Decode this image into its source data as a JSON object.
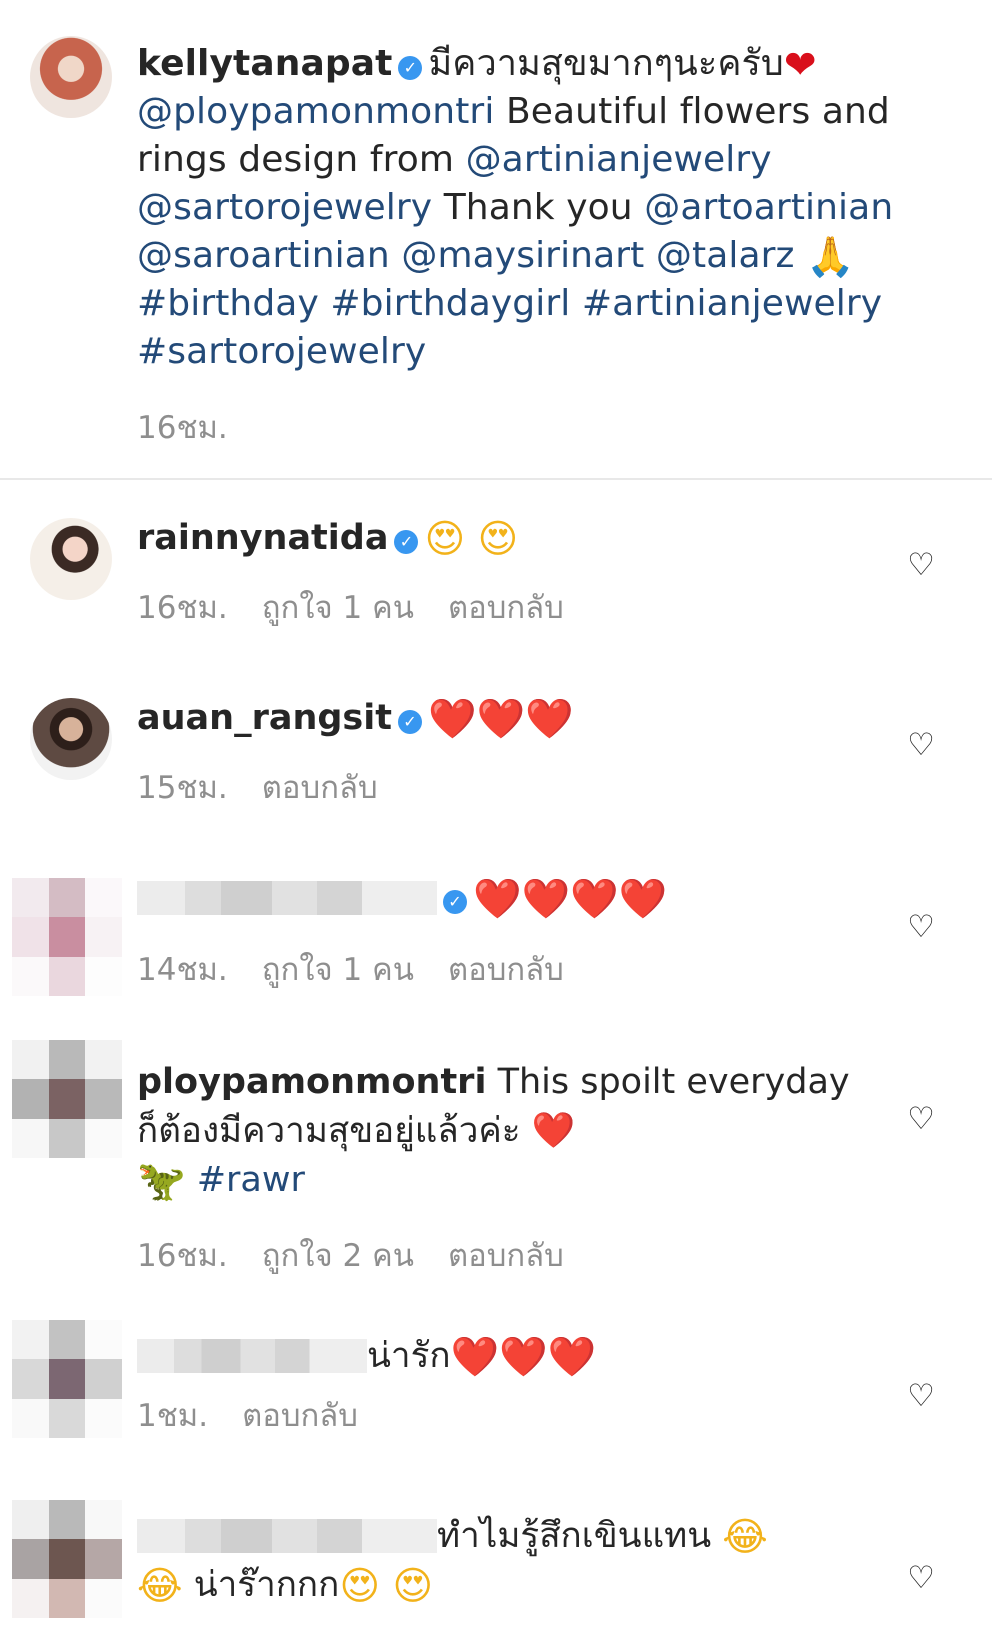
{
  "caption": {
    "username": "kellytanapat",
    "text_1": "มีความสุขมากๆนะครับ",
    "mention_1": "@ploypamonmontri",
    "text_2": " Beautiful flowers and rings design from ",
    "mention_2": "@artinianjewelry",
    "mention_3": "@sartorojewelry",
    "text_3": " Thank you ",
    "mention_4": "@artoartinian",
    "mention_5": "@saroartinian",
    "mention_6": "@maysirinart",
    "mention_7": "@talarz",
    "emoji_pray": "🙏",
    "tag_1": "#birthday",
    "tag_2": "#birthdaygirl",
    "tag_3": "#artinianjewelry",
    "tag_4": "#sartorojewelry",
    "time": "16ชม."
  },
  "comments": [
    {
      "username": "rainnynatida",
      "emoji": "😍 😍",
      "time": "16ชม.",
      "likes": "ถูกใจ 1 คน",
      "reply": "ตอบกลับ"
    },
    {
      "username": "auan_rangsit",
      "emoji": "❤️❤️❤️",
      "time": "15ชม.",
      "reply": "ตอบกลับ"
    },
    {
      "username": "",
      "emoji": "❤️❤️❤️❤️",
      "time": "14ชม.",
      "likes": "ถูกใจ 1 คน",
      "reply": "ตอบกลับ"
    },
    {
      "username": "ploypamonmontri",
      "text": " This spoilt everyday ก็ต้องมีความสุขอยู่แล้วค่ะ ❤️",
      "emoji": "🦖",
      "tag": "#rawr",
      "time": "16ชม.",
      "likes": "ถูกใจ 2 คน",
      "reply": "ตอบกลับ"
    },
    {
      "username": "",
      "text": "น่ารัก",
      "emoji": "❤️❤️❤️",
      "time": "1ชม.",
      "reply": "ตอบกลับ"
    },
    {
      "username": "",
      "text": "ทำไมรู้สึกเขินแทน",
      "emoji_1": "😂",
      "emoji_2": "😂",
      "text_2": " น่าร๊ากกก",
      "emoji_3": "😍 😍"
    }
  ],
  "icons": {
    "verified": "verified-icon",
    "like": "heart-outline-icon"
  },
  "colors": {
    "link": "#234a78",
    "muted": "#8e8e8e",
    "verified": "#3897f0",
    "divider": "#e8e8e8"
  }
}
